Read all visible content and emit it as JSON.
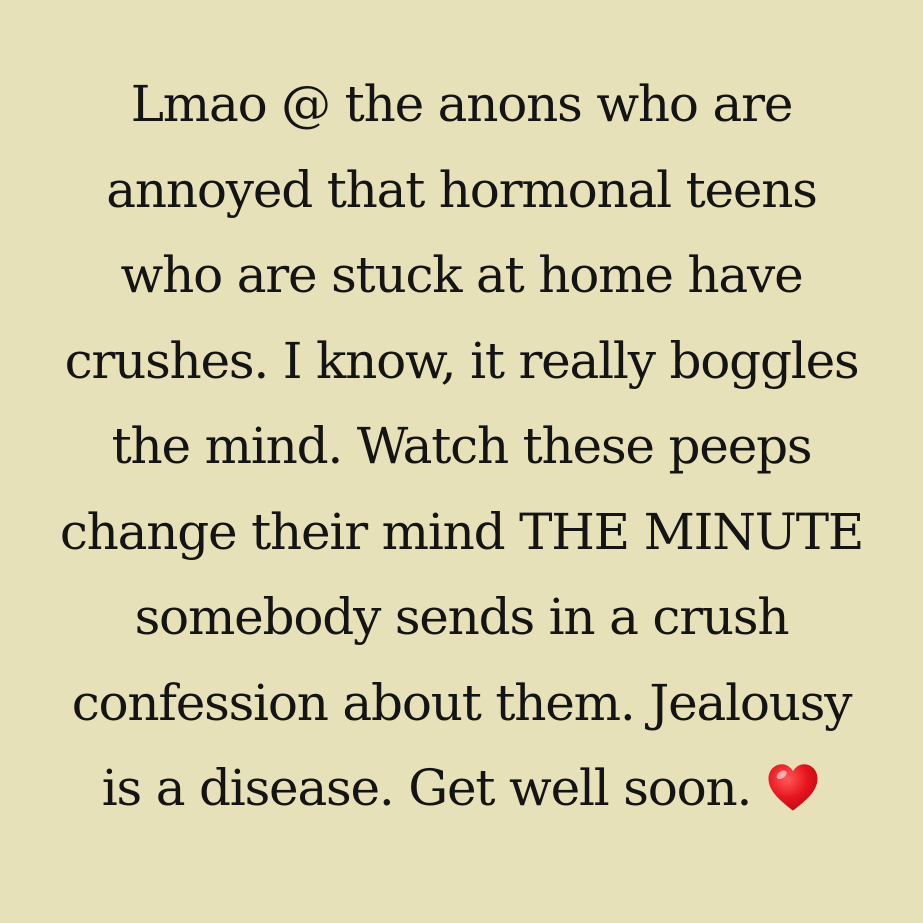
{
  "post": {
    "lines": [
      "Lmao @ the anons who are",
      "annoyed that hormonal teens",
      "who are stuck at home have",
      "crushes. I know, it really boggles",
      "the mind. Watch these peeps",
      "change their mind THE MINUTE",
      "somebody sends in a crush",
      "confession about them. Jealousy",
      "is a disease. Get well soon."
    ],
    "emoji": "heart-emoji"
  },
  "colors": {
    "background": "#e6e1b8",
    "text": "#141414",
    "heart": "#e8141e"
  }
}
